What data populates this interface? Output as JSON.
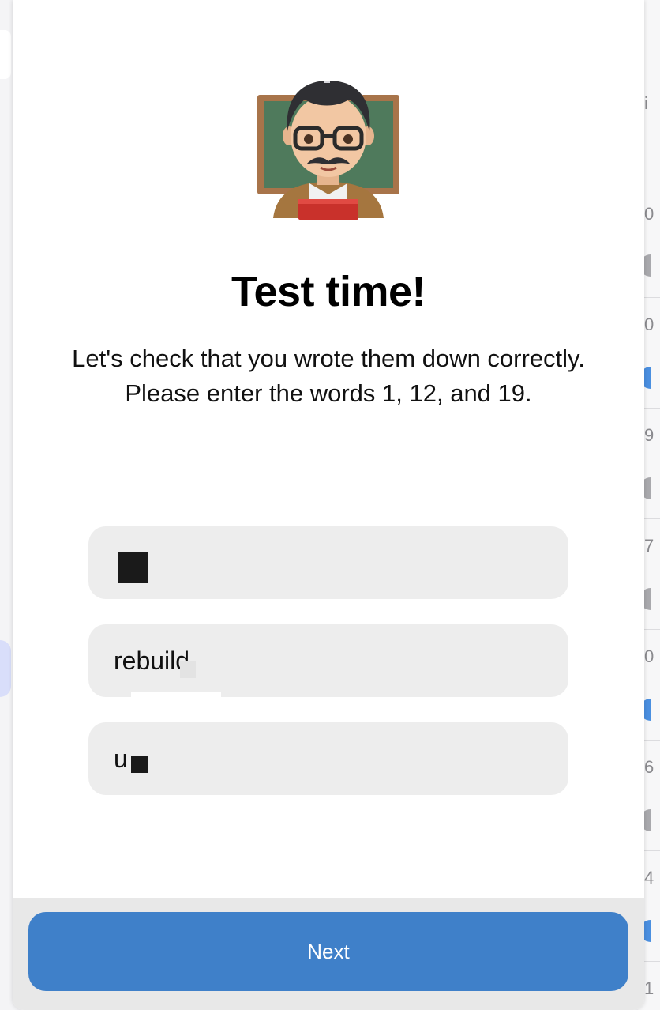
{
  "modal": {
    "title": "Test time!",
    "description": "Let's check that you wrote them down correctly. Please enter the words 1, 12, and 19.",
    "emoji": "teacher-emoji"
  },
  "fields": [
    {
      "value": "",
      "redacted": true
    },
    {
      "value": "rebuild",
      "redacted": true
    },
    {
      "value": "u",
      "redacted": true
    }
  ],
  "footer": {
    "next_label": "Next"
  },
  "background": {
    "right_column_glyphs": [
      "i",
      "0",
      "0",
      "9",
      "7",
      "0",
      "6",
      "4",
      "1"
    ]
  },
  "colors": {
    "primary": "#3f80c9",
    "field_bg": "#ededed",
    "footer_bg": "#e8e8e8"
  }
}
